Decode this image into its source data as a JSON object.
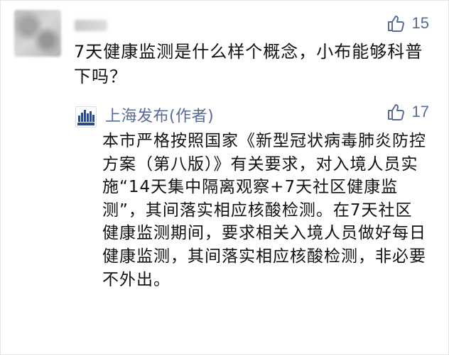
{
  "comment": {
    "likes": "15",
    "text": "7天健康监测是什么样个概念，小布能够科普下吗？"
  },
  "reply": {
    "author": "上海发布(作者)",
    "likes": "17",
    "text": "本市严格按照国家《新型冠状病毒肺炎防控方案（第八版）》有关要求，对入境人员实施“14天集中隔离观察+7天社区健康监测”，其间落实相应核酸检测。在7天社区健康监测期间，要求相关入境人员做好每日健康监测，其间落实相应核酸检测，非必要不外出。"
  },
  "colors": {
    "accent": "#576b95",
    "text": "#111111"
  },
  "icons": {
    "like": "thumbs-up-icon",
    "logo": "shanghai-fabu-logo"
  }
}
